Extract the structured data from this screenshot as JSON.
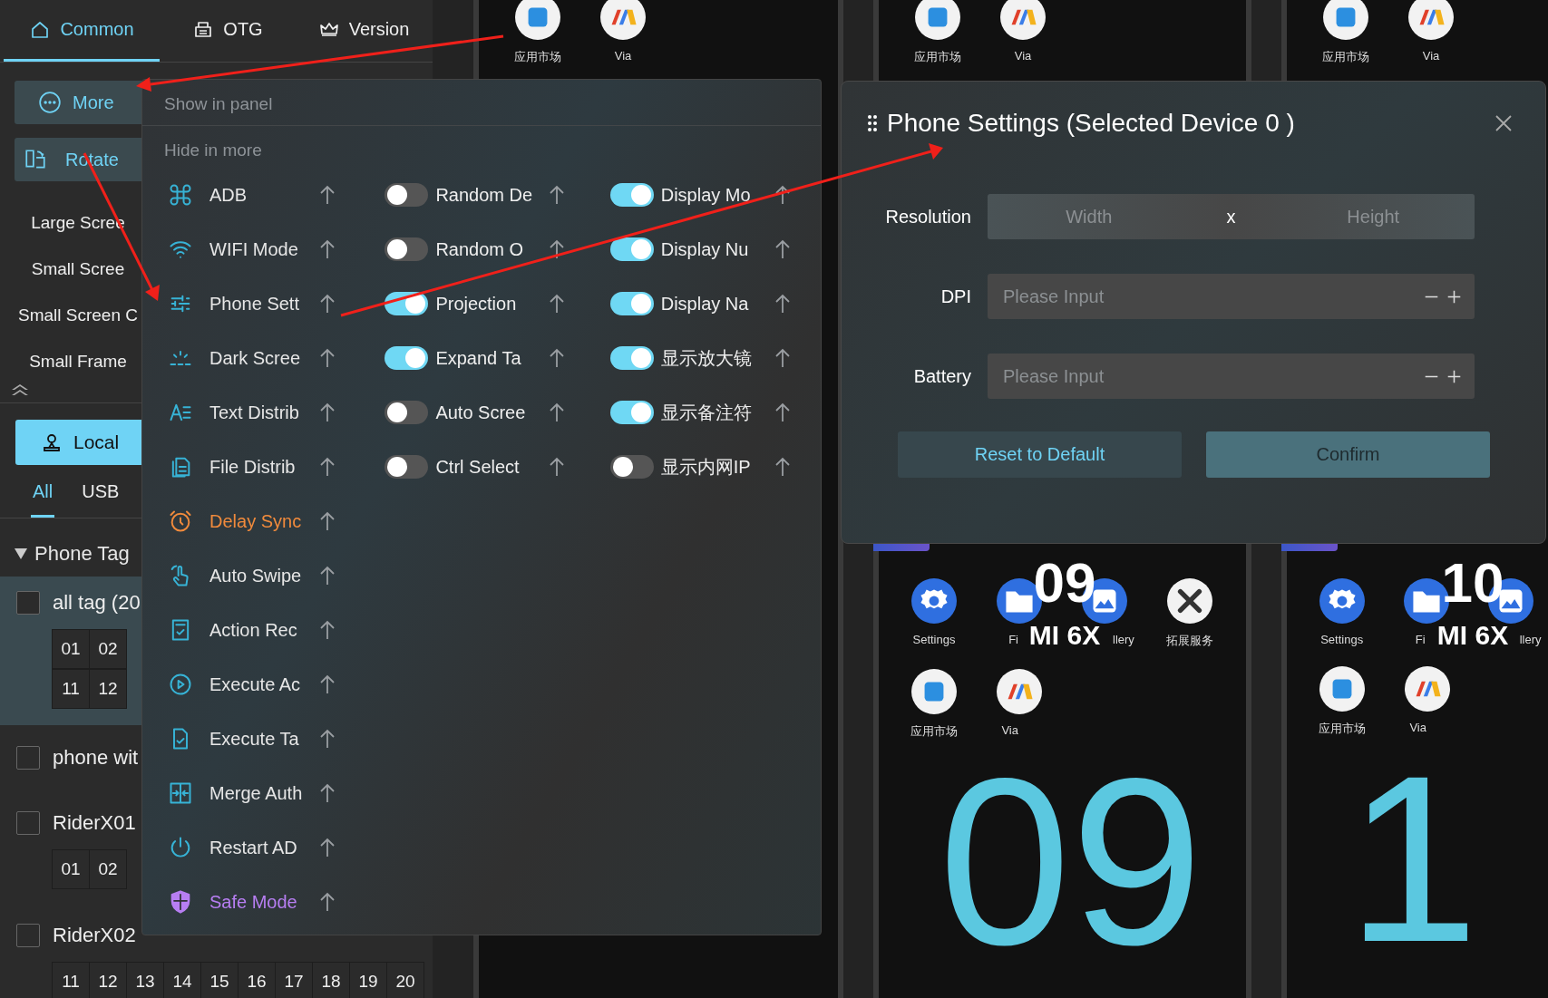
{
  "sidebar": {
    "tabs": [
      {
        "label": "Common",
        "selected": true
      },
      {
        "label": "OTG",
        "selected": false
      },
      {
        "label": "Version",
        "selected": false
      }
    ],
    "actions": [
      {
        "label": "More"
      },
      {
        "label": "Rotate"
      }
    ],
    "options": [
      "Large Scree",
      "Small Scree",
      "Small Screen C",
      "Small Frame"
    ],
    "source_button": "Local",
    "source_tabs": [
      {
        "label": "All",
        "selected": true
      },
      {
        "label": "USB",
        "selected": false
      }
    ],
    "tags_heading": "Phone Tag",
    "groups": [
      {
        "name": "all tag (20",
        "checked": false,
        "selected": true,
        "numbers": [
          [
            "01",
            "02"
          ],
          [
            "11",
            "12"
          ]
        ]
      },
      {
        "name": "phone wit",
        "checked": false,
        "selected": false
      },
      {
        "name": "RiderX01",
        "checked": false,
        "selected": false,
        "numbers": [
          [
            "01",
            "02"
          ]
        ]
      },
      {
        "name": "RiderX02",
        "checked": false,
        "selected": false,
        "numbers": [
          [
            "11",
            "12",
            "13",
            "14",
            "15",
            "16",
            "17",
            "18",
            "19",
            "20"
          ]
        ]
      }
    ]
  },
  "more_menu": {
    "show_heading": "Show in panel",
    "hide_heading": "Hide in more",
    "actions": [
      {
        "label": "ADB"
      },
      {
        "label": "WIFI Mode"
      },
      {
        "label": "Phone Sett"
      },
      {
        "label": "Dark Scree"
      },
      {
        "label": "Text Distrib"
      },
      {
        "label": "File Distrib"
      },
      {
        "label": "Delay Sync",
        "color": "#f08a3c"
      },
      {
        "label": "Auto Swipe"
      },
      {
        "label": "Action Rec"
      },
      {
        "label": "Execute Ac"
      },
      {
        "label": "Execute Ta"
      },
      {
        "label": "Merge Auth"
      },
      {
        "label": "Restart AD"
      },
      {
        "label": "Safe Mode",
        "color": "#b77ef2"
      }
    ],
    "toggles": [
      {
        "label": "Random De",
        "on": false
      },
      {
        "label": "Random O",
        "on": false
      },
      {
        "label": "Projection",
        "on": true
      },
      {
        "label": "Expand Ta",
        "on": true
      },
      {
        "label": "Auto Scree",
        "on": false
      },
      {
        "label": "Ctrl Select",
        "on": false
      }
    ],
    "display_toggles": [
      {
        "label": "Display Mo",
        "on": true
      },
      {
        "label": "Display Nu",
        "on": true
      },
      {
        "label": "Display Na",
        "on": true
      },
      {
        "label": "显示放大镜",
        "on": true
      },
      {
        "label": "显示备注符",
        "on": true
      },
      {
        "label": "显示内网IP",
        "on": false
      }
    ]
  },
  "dialog": {
    "title": "Phone Settings (Selected Device 0 )",
    "resolution": {
      "label": "Resolution",
      "width_placeholder": "Width",
      "separator": "x",
      "height_placeholder": "Height"
    },
    "fields": [
      {
        "label": "DPI",
        "placeholder": "Please Input"
      },
      {
        "label": "Battery",
        "placeholder": "Please Input"
      }
    ],
    "buttons": [
      {
        "label": "Reset to Default",
        "kind": "secondary"
      },
      {
        "label": "Confirm",
        "kind": "primary"
      }
    ]
  },
  "phones": [
    {
      "top_apps": [
        "应用市场",
        "Via"
      ]
    },
    {
      "top_apps": [
        "应用市场",
        "Via"
      ],
      "apps": [
        [
          "Settings",
          "Fi",
          "llery",
          "拓展服务"
        ],
        [
          "应用市场",
          "Via"
        ]
      ],
      "number": "09",
      "model": "MI 6X",
      "big_number": "09"
    },
    {
      "top_apps": [
        "应用市场",
        "Via"
      ],
      "apps": [
        [
          "Settings",
          "Fi",
          "llery"
        ],
        [
          "应用市场",
          "Via"
        ]
      ],
      "number": "10",
      "model": "MI 6X",
      "big_number": "1"
    }
  ]
}
